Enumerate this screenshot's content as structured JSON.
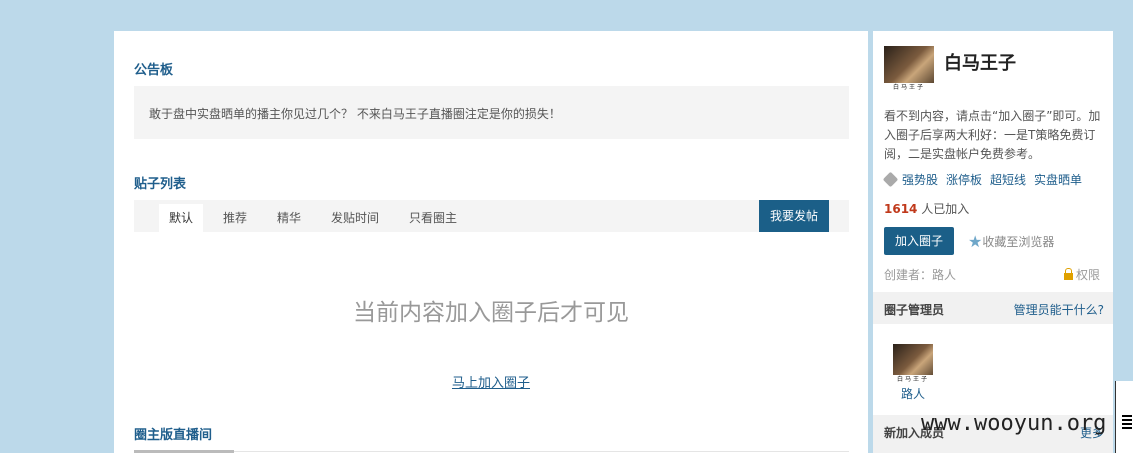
{
  "notice": {
    "title": "公告板",
    "text": "敢于盘中实盘晒单的播主你见过几个？ 不来白马王子直播圈注定是你的损失！"
  },
  "posts": {
    "title": "贴子列表",
    "tabs": [
      "默认",
      "推荐",
      "精华",
      "发贴时间",
      "只看圈主"
    ],
    "post_button": "我要发帖",
    "locked_message": "当前内容加入圈子后才可见",
    "join_link": "马上加入圈子"
  },
  "live": {
    "title": "圈主版直播间"
  },
  "sidebar": {
    "avatar_caption": "白马王子",
    "group_name": "白马王子",
    "description": "看不到内容，请点击“加入圈子”即可。加入圈子后享两大利好：一是T策略免费订阅，二是实盘帐户免费参考。",
    "tags": [
      "强势股",
      "涨停板",
      "超短线",
      "实盘晒单"
    ],
    "member_count": "1614",
    "member_suffix": " 人已加入",
    "join_button": "加入圈子",
    "favorite": "收藏至浏览器",
    "creator": "创建者：路人",
    "permission": "权限",
    "admin_title": "圈子管理员",
    "admin_question": "管理员能干什么?",
    "admin_name": "路人",
    "new_members_title": "新加入成员",
    "more": "更多"
  },
  "watermark": "www.wooyun.org"
}
